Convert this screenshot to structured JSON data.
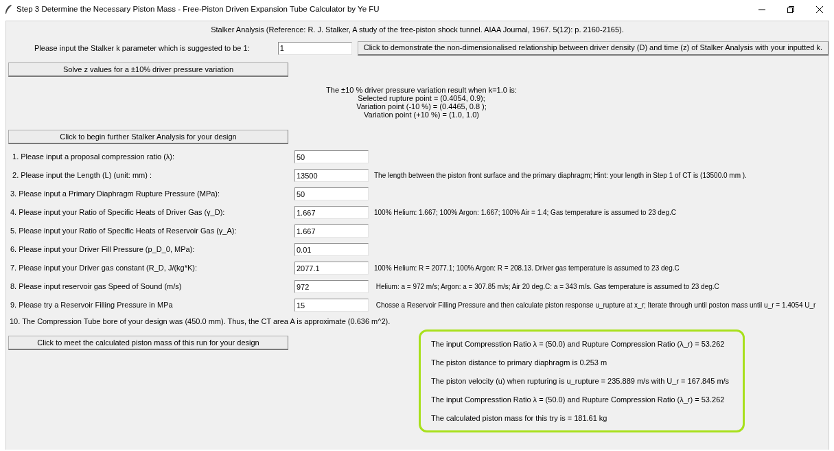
{
  "window": {
    "title": "Step 3 Determine the Necessary Piston Mass - Free-Piston Driven Expansion Tube Calculator by Ye FU"
  },
  "header": "Stalker Analysis (Reference: R. J. Stalker, A study of the free-piston shock tunnel. AIAA Journal, 1967. 5(12): p. 2160-2165).",
  "k_row": {
    "label": "Please input the Stalker k parameter which is suggested to be 1:",
    "value": "1",
    "button": "Click to demonstrate the non-dimensionalised relationship between driver density (D) and time (z) of Stalker Analysis with your inputted k."
  },
  "solve_button": "Solve z values for a ±10% driver pressure variation",
  "variation_result": [
    "The ±10 % driver pressure variation result when k=1.0 is:",
    "Selected rupture point = (0.4054, 0.9);",
    "Variation point (-10 %) = (0.4465, 0.8 );",
    "Variation point (+10 %) = (1.0, 1.0)"
  ],
  "further_button": "Click to begin further Stalker Analysis for your design",
  "fields": [
    {
      "label": " 1. Please input a proposal compression ratio (λ):",
      "value": "50"
    },
    {
      "label": " 2. Please input the Length (L) (unit: mm) :",
      "value": "13500",
      "hint": "The length between the piston front surface and the primary diaphragm; Hint: your length in Step 1 of CT is (13500.0 mm )."
    },
    {
      "label": "3. Please input a Primary Diaphragm Rupture Pressure (MPa):",
      "value": "50"
    },
    {
      "label": "4. Please input your Ratio of Specific Heats of Driver Gas (γ_D):",
      "value": "1.667",
      "hint": "100% Helium: 1.667; 100% Argon: 1.667; 100% Air = 1.4; Gas temperature is assumed to 23 deg.C"
    },
    {
      "label": "5. Please input your Ratio of Specific Heats of Reservoir Gas (γ_A):",
      "value": "1.667"
    },
    {
      "label": "6. Please input your Driver Fill Pressure (p_D_0, MPa):",
      "value": "0.01"
    },
    {
      "label": "7. Please input your Driver gas constant (R_D, J/(kg*K):",
      "value": "2077.1",
      "hint": "100% Helium: R = 2077.1; 100% Argon: R = 208.13. Driver gas temperature is assumed to 23 deg.C"
    },
    {
      "label": "8. Please input reservoir gas Speed of Sound (m/s)",
      "value": "972",
      "hint": " Helium: a = 972 m/s; Argon: a = 307.85 m/s; Air 20 deg.C: a = 343 m/s. Gas temperature is assumed to 23 deg.C"
    },
    {
      "label": "9. Please try a Reservoir Filling Pressure in MPa",
      "value": "15",
      "hint": " Chosse a Reservoir Filling Pressure and then calculate piston response u_rupture at x_r; Iterate through until poston mass until u_r = 1.4054 U_r"
    }
  ],
  "bore_note": "10. The Compression Tube bore of your design was (450.0 mm). Thus, the CT area A is approximate (0.636 m^2).",
  "mass_button": "Click to meet the calculated piston mass of this run for your design",
  "results_panel": [
    "The input Compresstion Ratio λ = (50.0) and Rupture Compression Ratio (λ_r) = 53.262",
    "The piston distance to primary diaphragm is 0.253 m",
    "The piston velocity (u) when rupturing is u_rupture = 235.889 m/s with U_r = 167.845 m/s",
    "The input Compresstion Ratio λ = (50.0) and Rupture Compression Ratio (λ_r) = 53.262",
    "The calculated piston mass for this try is = 181.61 kg"
  ]
}
